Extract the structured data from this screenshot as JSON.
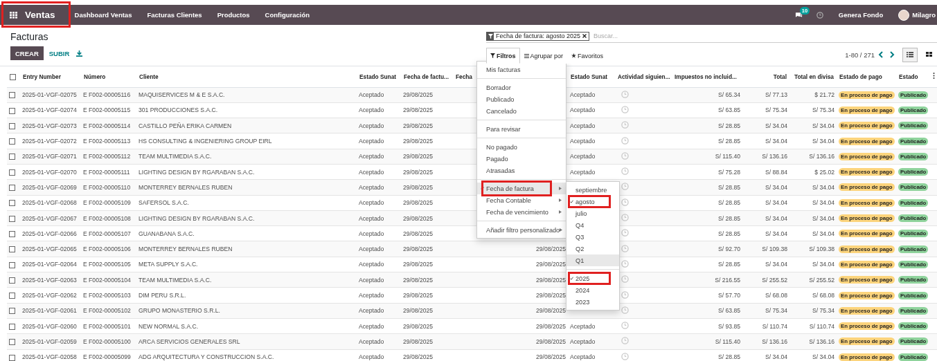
{
  "navbar": {
    "brand": {
      "label": "Ventas",
      "highlighted": true
    },
    "menu": [
      "Dashboard Ventas",
      "Facturas Clientes",
      "Productos",
      "Configuración"
    ],
    "messages_badge": "10",
    "company": "Genera Fondo",
    "user": "Milagro"
  },
  "control_panel": {
    "title": "Facturas",
    "buttons": {
      "create": "CREAR",
      "upload": "SUBIR"
    },
    "facet": "Fecha de factura: agosto 2025",
    "search": {
      "placeholder": "Buscar..."
    },
    "search_tabs": [
      {
        "label": "Filtros",
        "selected": true,
        "kind": "filter"
      },
      {
        "label": "Agrupar por",
        "selected": false,
        "kind": "group"
      },
      {
        "label": "Favoritos",
        "selected": false,
        "kind": "favorite"
      }
    ],
    "pager": "1-80 / 271",
    "views": [
      {
        "kind": "list",
        "selected": true
      },
      {
        "kind": "kanban",
        "selected": false
      }
    ]
  },
  "filter_menu": {
    "groups": [
      [
        {
          "label": "Mis facturas",
          "kind": "option",
          "checked": false,
          "active": false,
          "highlighted": false
        }
      ],
      [
        {
          "label": "Borrador",
          "kind": "option",
          "checked": false,
          "active": false,
          "highlighted": false
        },
        {
          "label": "Publicado",
          "kind": "option",
          "checked": false,
          "active": false,
          "highlighted": false
        },
        {
          "label": "Cancelado",
          "kind": "option",
          "checked": false,
          "active": false,
          "highlighted": false
        }
      ],
      [
        {
          "label": "Para revisar",
          "kind": "option",
          "checked": false,
          "active": false,
          "highlighted": false
        }
      ],
      [
        {
          "label": "No pagado",
          "kind": "option",
          "checked": false,
          "active": false,
          "highlighted": false
        },
        {
          "label": "Pagado",
          "kind": "option",
          "checked": false,
          "active": false,
          "highlighted": false
        },
        {
          "label": "Atrasadas",
          "kind": "option",
          "checked": false,
          "active": false,
          "highlighted": false
        }
      ],
      [
        {
          "label": "Fecha de factura",
          "kind": "submenu",
          "checked": true,
          "active": true,
          "highlighted": true
        },
        {
          "label": "Fecha Contable",
          "kind": "submenu",
          "checked": false,
          "active": false,
          "highlighted": false
        },
        {
          "label": "Fecha de vencimiento",
          "kind": "submenu",
          "checked": false,
          "active": false,
          "highlighted": false
        }
      ],
      [
        {
          "label": "Añadir filtro personalizado",
          "kind": "submenu",
          "checked": false,
          "active": false,
          "highlighted": false
        }
      ]
    ]
  },
  "date_submenu": {
    "groups": [
      [
        {
          "label": "septiembre",
          "checked": false,
          "active": false,
          "highlighted": false
        },
        {
          "label": "agosto",
          "checked": true,
          "active": false,
          "highlighted": true
        },
        {
          "label": "julio",
          "checked": false,
          "active": false,
          "highlighted": false
        },
        {
          "label": "Q4",
          "checked": false,
          "active": false,
          "highlighted": false
        },
        {
          "label": "Q3",
          "checked": false,
          "active": false,
          "highlighted": false
        },
        {
          "label": "Q2",
          "checked": false,
          "active": false,
          "highlighted": false
        },
        {
          "label": "Q1",
          "checked": false,
          "active": true,
          "highlighted": false
        }
      ],
      [
        {
          "label": "2025",
          "checked": true,
          "active": false,
          "highlighted": true
        },
        {
          "label": "2024",
          "checked": false,
          "active": false,
          "highlighted": false
        },
        {
          "label": "2023",
          "checked": false,
          "active": false,
          "highlighted": false
        }
      ]
    ]
  },
  "table": {
    "all_checked": false,
    "columns": [
      {
        "label": "Entry Number",
        "kind": "text"
      },
      {
        "label": "Número",
        "kind": "text"
      },
      {
        "label": "Cliente",
        "kind": "text"
      },
      {
        "label": "Estado Sunat",
        "kind": "text"
      },
      {
        "label": "Fecha de factu...",
        "kind": "text"
      },
      {
        "label": "Fecha",
        "kind": "date_right"
      },
      {
        "label": "Estado Sunat",
        "kind": "text"
      },
      {
        "label": "Actividad siguien...",
        "kind": "activity"
      },
      {
        "label": "Impuestos no incluid...",
        "kind": "num"
      },
      {
        "label": "Total",
        "kind": "num"
      },
      {
        "label": "Total en divisa",
        "kind": "num"
      },
      {
        "label": "Estado de pago",
        "kind": "pay_badge"
      },
      {
        "label": "Estado",
        "kind": "state_badge"
      }
    ],
    "rows": [
      {
        "checked": false,
        "cells": [
          "2025-01-VGF-02075",
          "E F002-00005116",
          "MAQUISERVICES M & E S.A.C.",
          "Aceptado",
          "29/08/2025",
          null,
          "Aceptado",
          null,
          "S/ 65.34",
          "S/ 77.13",
          "$ 21.72",
          "En proceso de pago",
          "Publicado"
        ]
      },
      {
        "checked": false,
        "cells": [
          "2025-01-VGF-02074",
          "E F002-00005115",
          "301 PRODUCCIONES S.A.C.",
          "Aceptado",
          "29/08/2025",
          null,
          "Aceptado",
          null,
          "S/ 63.85",
          "S/ 75.34",
          "S/ 75.34",
          "En proceso de pago",
          "Publicado"
        ]
      },
      {
        "checked": false,
        "cells": [
          "2025-01-VGF-02073",
          "E F002-00005114",
          "CASTILLO PEÑA ERIKA CARMEN",
          "Aceptado",
          "29/08/2025",
          null,
          "Aceptado",
          null,
          "S/ 28.85",
          "S/ 34.04",
          "S/ 34.04",
          "En proceso de pago",
          "Publicado"
        ]
      },
      {
        "checked": false,
        "cells": [
          "2025-01-VGF-02072",
          "E F002-00005113",
          "HS CONSULTING & INGENIERING GROUP EIRL",
          "Aceptado",
          "29/08/2025",
          null,
          "Aceptado",
          null,
          "S/ 28.85",
          "S/ 34.04",
          "S/ 34.04",
          "En proceso de pago",
          "Publicado"
        ]
      },
      {
        "checked": false,
        "cells": [
          "2025-01-VGF-02071",
          "E F002-00005112",
          "TEAM MULTIMEDIA S.A.C.",
          "Aceptado",
          "29/08/2025",
          null,
          "Aceptado",
          null,
          "S/ 115.40",
          "S/ 136.16",
          "S/ 136.16",
          "En proceso de pago",
          "Publicado"
        ]
      },
      {
        "checked": false,
        "cells": [
          "2025-01-VGF-02070",
          "E F002-00005111",
          "LIGHTING DESIGN BY RGARABAN S.A.C.",
          "Aceptado",
          "29/08/2025",
          null,
          "Aceptado",
          null,
          "S/ 75.28",
          "S/ 88.84",
          "$ 25.02",
          "En proceso de pago",
          "Publicado"
        ]
      },
      {
        "checked": false,
        "cells": [
          "2025-01-VGF-02069",
          "E F002-00005110",
          "MONTERREY BERNALES RUBEN",
          "Aceptado",
          "29/08/2025",
          null,
          null,
          null,
          "S/ 28.85",
          "S/ 34.04",
          "S/ 34.04",
          "En proceso de pago",
          "Publicado"
        ]
      },
      {
        "checked": false,
        "cells": [
          "2025-01-VGF-02068",
          "E F002-00005109",
          "SAFERSOL S.A.C.",
          "Aceptado",
          "29/08/2025",
          null,
          null,
          null,
          "S/ 28.85",
          "S/ 34.04",
          "S/ 34.04",
          "En proceso de pago",
          "Publicado"
        ]
      },
      {
        "checked": false,
        "cells": [
          "2025-01-VGF-02067",
          "E F002-00005108",
          "LIGHTING DESIGN BY RGARABAN S.A.C.",
          "Aceptado",
          "29/08/2025",
          null,
          null,
          null,
          "S/ 28.85",
          "S/ 34.04",
          "S/ 34.04",
          "En proceso de pago",
          "Publicado"
        ]
      },
      {
        "checked": false,
        "cells": [
          "2025-01-VGF-02066",
          "E F002-00005107",
          "GUANABANA S.A.C.",
          "Aceptado",
          "29/08/2025",
          null,
          null,
          null,
          "S/ 28.85",
          "S/ 34.04",
          "S/ 34.04",
          "En proceso de pago",
          "Publicado"
        ]
      },
      {
        "checked": false,
        "cells": [
          "2025-01-VGF-02065",
          "E F002-00005106",
          "MONTERREY BERNALES RUBEN",
          "Aceptado",
          "29/08/2025",
          "29/08/2025",
          null,
          null,
          "S/ 92.70",
          "S/ 109.38",
          "S/ 109.38",
          "En proceso de pago",
          "Publicado"
        ]
      },
      {
        "checked": false,
        "cells": [
          "2025-01-VGF-02064",
          "E F002-00005105",
          "META SUPPLY S.A.C.",
          "Aceptado",
          "29/08/2025",
          "29/08/2025",
          null,
          null,
          "S/ 28.85",
          "S/ 34.04",
          "S/ 34.04",
          "En proceso de pago",
          "Publicado"
        ]
      },
      {
        "checked": false,
        "cells": [
          "2025-01-VGF-02063",
          "E F002-00005104",
          "TEAM MULTIMEDIA S.A.C.",
          "Aceptado",
          "29/08/2025",
          "29/08/2025",
          null,
          null,
          "S/ 216.55",
          "S/ 255.52",
          "S/ 255.52",
          "En proceso de pago",
          "Publicado"
        ]
      },
      {
        "checked": false,
        "cells": [
          "2025-01-VGF-02062",
          "E F002-00005103",
          "DIM PERU S.R.L.",
          "Aceptado",
          "29/08/2025",
          "29/08/2025",
          null,
          null,
          "S/ 57.70",
          "S/ 68.08",
          "S/ 68.08",
          "En proceso de pago",
          "Publicado"
        ]
      },
      {
        "checked": false,
        "cells": [
          "2025-01-VGF-02061",
          "E F002-00005102",
          "GRUPO MONASTERIO S.R.L.",
          "Aceptado",
          "29/08/2025",
          "29/08/2025",
          null,
          null,
          "S/ 63.85",
          "S/ 75.34",
          "S/ 75.34",
          "En proceso de pago",
          "Publicado"
        ]
      },
      {
        "checked": false,
        "cells": [
          "2025-01-VGF-02060",
          "E F002-00005101",
          "NEW NORMAL S.A.C.",
          "Aceptado",
          "29/08/2025",
          "29/08/2025",
          "Aceptado",
          null,
          "S/ 93.85",
          "S/ 110.74",
          "S/ 110.74",
          "En proceso de pago",
          "Publicado"
        ]
      },
      {
        "checked": false,
        "cells": [
          "2025-01-VGF-02059",
          "E F002-00005100",
          "ARCA SERVICIOS GENERALES SRL",
          "Aceptado",
          "29/08/2025",
          "29/08/2025",
          "Aceptado",
          null,
          "S/ 115.40",
          "S/ 136.16",
          "S/ 136.16",
          "En proceso de pago",
          "Publicado"
        ]
      },
      {
        "checked": false,
        "cells": [
          "2025-01-VGF-02058",
          "E F002-00005099",
          "ADG ARQUITECTURA Y CONSTRUCCION S.A.C.",
          "Aceptado",
          "29/08/2025",
          "29/08/2025",
          "Aceptado",
          null,
          "S/ 28.85",
          "S/ 34.04",
          "S/ 34.04",
          "En proceso de pago",
          "Publicado"
        ]
      }
    ]
  }
}
